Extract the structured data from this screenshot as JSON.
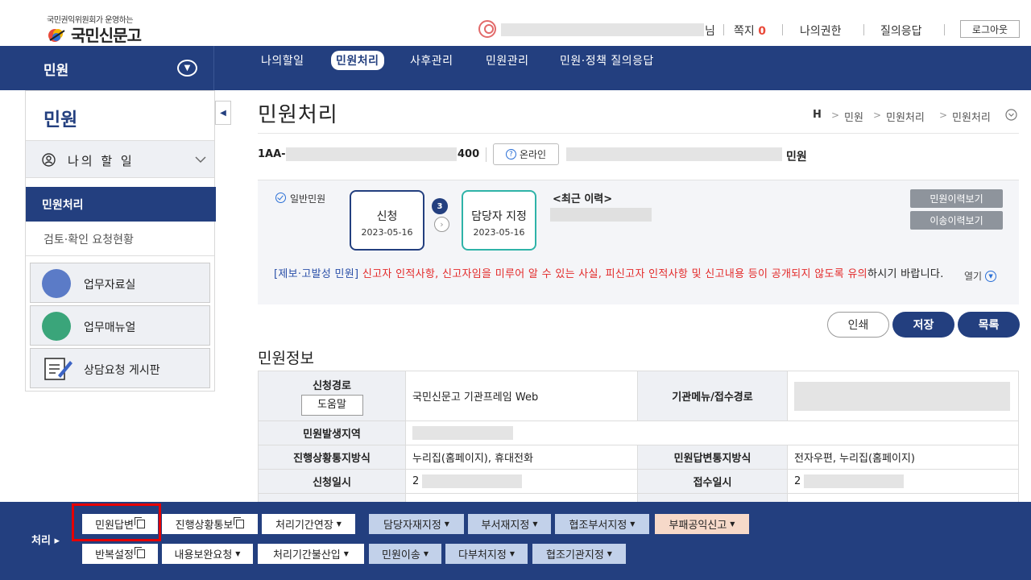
{
  "header": {
    "logo_small": "국민권익위원회가 운영하는",
    "logo_main": "국민신문고",
    "user_suffix": "님",
    "message_label": "쪽지",
    "message_count": "0",
    "nav": [
      "나의권한",
      "질의응답"
    ],
    "logout": "로그아웃"
  },
  "topmenu": {
    "section_title": "민원",
    "items": [
      "나의할일",
      "민원처리",
      "사후관리",
      "민원관리",
      "민원·정책 질의응답"
    ],
    "active_index": 1
  },
  "sidebar": {
    "title": "민원",
    "todo_label": "나의 할 일",
    "active_item": "민원처리",
    "sub_item": "검토·확인 요청현황",
    "boxes": [
      "업무자료실",
      "업무매뉴얼",
      "상담요청 게시판"
    ]
  },
  "page": {
    "title": "민원처리",
    "breadcrumb": [
      "H",
      "민원",
      "민원처리",
      "민원처리"
    ],
    "id_prefix": "1AA-",
    "id_suffix": "400",
    "online_label": "온라인",
    "civil_suffix": "민원"
  },
  "status": {
    "type_label": "일반민원",
    "steps": [
      {
        "title": "신청",
        "date": "2023-05-16"
      },
      {
        "title": "담당자 지정",
        "date": "2023-05-16"
      }
    ],
    "step_badge": "3",
    "recent_history_label": "<최근 이력>",
    "btn_history": "민원이력보기",
    "btn_transfer_history": "이송이력보기",
    "warning_prefix": "[제보·고발성 민원]",
    "warning_red": "신고자 인적사항, 신고자임을 미루어 알 수 있는 사실, 피신고자 인적사항 및 신고내용 등이 공개되지 않도록 유의",
    "warning_suffix": "하시기 바랍니다.",
    "open_label": "열기"
  },
  "actions": {
    "print": "인쇄",
    "save": "저장",
    "list": "목록"
  },
  "info": {
    "section_title": "민원정보",
    "route_label": "신청경로",
    "help_btn": "도움말",
    "route_value": "국민신문고 기관프레임 Web",
    "org_menu_label": "기관메뉴/접수경로",
    "region_label": "민원발생지역",
    "progress_notice_label": "진행상황통지방식",
    "progress_notice_value": "누리집(홈페이지), 휴대전화",
    "reply_notice_label": "민원답변통지방식",
    "reply_notice_value": "전자우편, 누리집(홈페이지)",
    "apply_date_label": "신청일시",
    "apply_date_prefix": "2",
    "receive_date_label": "접수일시",
    "receive_date_prefix": "2"
  },
  "bottom": {
    "label": "처리 ▸",
    "row1": [
      {
        "label": "민원답변",
        "kind": "white",
        "icon": "copy"
      },
      {
        "label": "진행상황통보",
        "kind": "white",
        "icon": "copy"
      },
      {
        "label": "처리기간연장",
        "kind": "white",
        "icon": "caret"
      },
      {
        "label": "담당자재지정",
        "kind": "lightblue",
        "icon": "caret"
      },
      {
        "label": "부서재지정",
        "kind": "lightblue",
        "icon": "caret"
      },
      {
        "label": "협조부서지정",
        "kind": "lightblue",
        "icon": "caret"
      },
      {
        "label": "부패공익신고",
        "kind": "pink",
        "icon": "caret"
      }
    ],
    "row2": [
      {
        "label": "반복설정",
        "kind": "white",
        "icon": "copy"
      },
      {
        "label": "내용보완요청",
        "kind": "white",
        "icon": "caret"
      },
      {
        "label": "처리기간불산입",
        "kind": "white",
        "icon": "caret"
      },
      {
        "label": "민원이송",
        "kind": "lightblue",
        "icon": "caret"
      },
      {
        "label": "다부처지정",
        "kind": "lightblue",
        "icon": "caret"
      },
      {
        "label": "협조기관지정",
        "kind": "lightblue",
        "icon": "caret"
      }
    ]
  },
  "colors": {
    "brand_navy": "#233f7f",
    "highlight_red": "#e60000",
    "warning_red": "#e32a2a"
  }
}
